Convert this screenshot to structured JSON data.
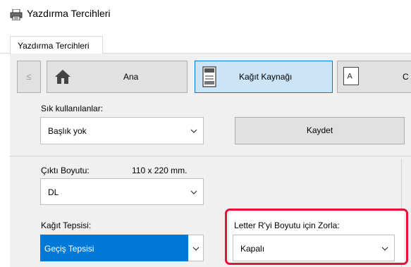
{
  "window": {
    "title": "Yazdırma Tercihleri"
  },
  "tabs": [
    {
      "label": "Yazdırma Tercihleri"
    }
  ],
  "nav": {
    "prev_label": "≤",
    "home_label": "Ana",
    "paper_label": "Kağıt Kaynağı",
    "output_label": "C"
  },
  "favorites": {
    "label": "Sık kullanılanlar:",
    "value": "Başlık yok",
    "save_label": "Kaydet"
  },
  "output_size": {
    "label": "Çıktı Boyutu:",
    "dimension_text": "110 x 220 mm.",
    "value": "DL"
  },
  "paper_tray": {
    "label": "Kağıt Tepsisi:",
    "value": "Geçiş Tepsisi"
  },
  "force_letter": {
    "label": "Letter R'yi Boyutu için Zorla:",
    "value": "Kapalı"
  },
  "colors": {
    "accent": "#0078d7",
    "highlight_frame": "#e0143c",
    "selected_nav": "#cce4f7"
  }
}
